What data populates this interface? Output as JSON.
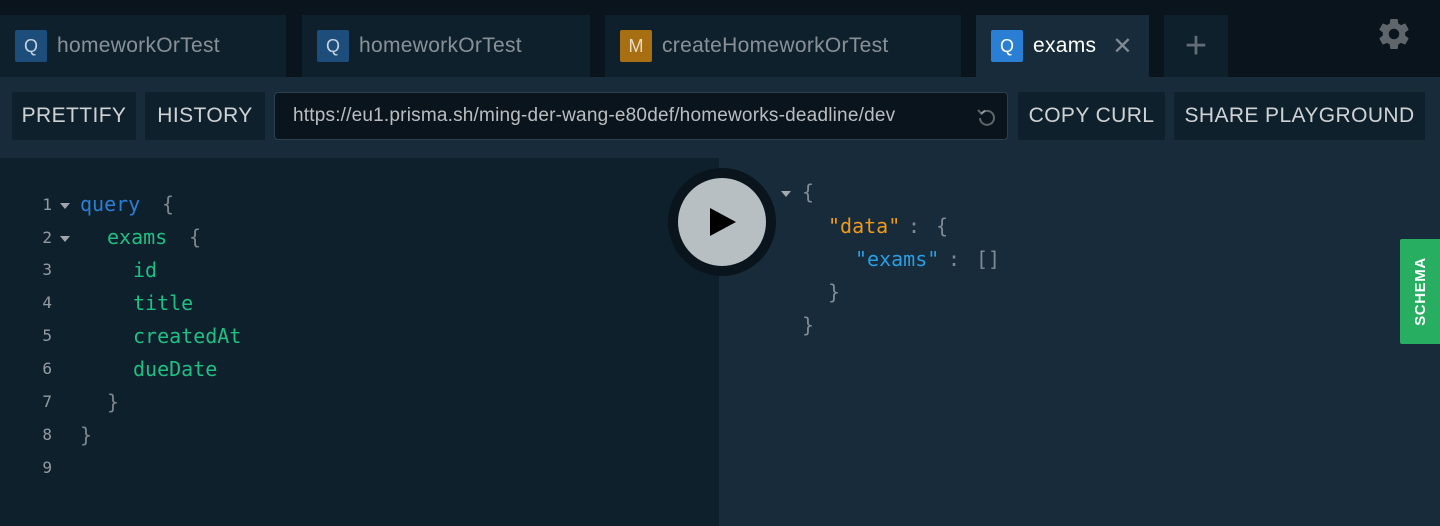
{
  "tabs": [
    {
      "badge": "Q",
      "label": "homeworkOrTest"
    },
    {
      "badge": "Q",
      "label": "homeworkOrTest"
    },
    {
      "badge": "M",
      "label": "createHomeworkOrTest"
    },
    {
      "badge": "Q",
      "label": "exams",
      "close": "✕"
    }
  ],
  "add_tab": "+",
  "toolbar": {
    "prettify": "PRETTIFY",
    "history": "HISTORY",
    "url": "https://eu1.prisma.sh/ming-der-wang-e80def/homeworks-deadline/dev",
    "copy_curl": "COPY CURL",
    "share": "SHARE PLAYGROUND"
  },
  "editor": {
    "line_numbers": [
      "1",
      "2",
      "3",
      "4",
      "5",
      "6",
      "7",
      "8",
      "9"
    ],
    "lines": {
      "l1_kw": "query",
      "l1_brace": "{",
      "l2_field": "exams",
      "l2_brace": "{",
      "l3": "id",
      "l4": "title",
      "l5": "createdAt",
      "l6": "dueDate",
      "l7": "}",
      "l8": "}"
    }
  },
  "result": {
    "open": "{",
    "data_key": "\"data\"",
    "colon": ":",
    "data_open": "{",
    "exams_key": "\"exams\"",
    "exams_val": "[]",
    "data_close": "}",
    "close": "}"
  },
  "schema_tab": "SCHEMA",
  "colors": {
    "background": "#0f202d",
    "results_bg": "#172b3a",
    "keyword": "#2a7ed3",
    "field": "#1fbf82",
    "string_key": "#f09a1c",
    "schema": "#27ae60"
  }
}
